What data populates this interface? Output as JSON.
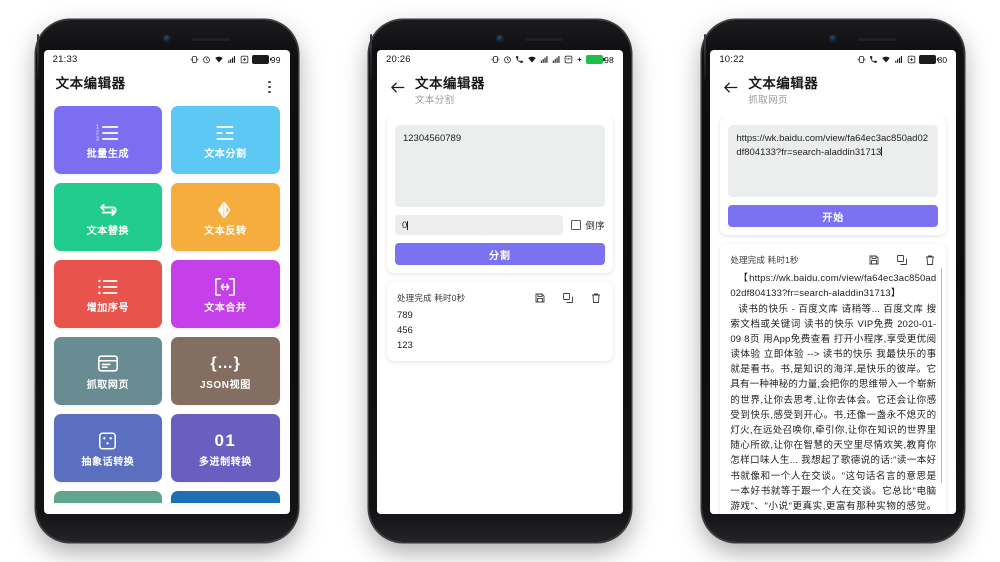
{
  "meta": {
    "app_name": "文本编辑器"
  },
  "phone1": {
    "statusbar": {
      "time": "21:33",
      "battery_level": "99",
      "battery_green": false,
      "icons": [
        "vibrate-icon",
        "alarm-icon",
        "wifi-icon",
        "signal-icon",
        "sync-icon",
        "battery-icon"
      ]
    },
    "appbar": {
      "title": "文本编辑器",
      "has_back": false,
      "overflow": "overflow-menu"
    },
    "tiles": [
      {
        "label": "批量生成",
        "color": "#7b6ef0",
        "icon": "numbered-list-icon"
      },
      {
        "label": "文本分割",
        "color": "#5ec8f5",
        "icon": "split-lines-icon"
      },
      {
        "label": "文本替换",
        "color": "#22cb8e",
        "icon": "swap-arrows-icon"
      },
      {
        "label": "文本反转",
        "color": "#f5ad3e",
        "icon": "mirror-flip-icon"
      },
      {
        "label": "增加序号",
        "color": "#e8544c",
        "icon": "bullet-list-icon"
      },
      {
        "label": "文本合并",
        "color": "#c540e8",
        "icon": "merge-icon"
      },
      {
        "label": "抓取网页",
        "color": "#688c91",
        "icon": "webpage-icon"
      },
      {
        "label": "JSON视图",
        "color": "#846e61",
        "icon": "braces-icon"
      },
      {
        "label": "抽象话转换",
        "color": "#5a6fc0",
        "icon": "dice-icon"
      },
      {
        "label": "多进制转换",
        "color": "#6a5ec0",
        "icon": "01-text-icon",
        "text_icon": "01"
      }
    ],
    "tiles_partial": [
      {
        "color": "#5fa58f"
      },
      {
        "color": "#1f6fb5"
      }
    ]
  },
  "phone2": {
    "statusbar": {
      "time": "20:26",
      "battery_level": "98",
      "battery_green": true,
      "icons": [
        "vibrate-icon",
        "alarm-icon",
        "call-icon",
        "wifi-icon",
        "signal-icon",
        "signal-icon",
        "sd-icon",
        "plus-icon",
        "battery-icon"
      ]
    },
    "appbar": {
      "title": "文本编辑器",
      "subtitle": "文本分割",
      "has_back": true
    },
    "input": {
      "value": "12304560789",
      "placeholder": ""
    },
    "separator_input": {
      "value": "0",
      "placeholder": ""
    },
    "reverse_checkbox": {
      "label": "倒序",
      "checked": false
    },
    "submit_button": {
      "label": "分割"
    },
    "result": {
      "status": "处理完成 耗时0秒",
      "actions": [
        "save-icon",
        "copy-icon",
        "delete-icon"
      ],
      "text": "789\n456\n123"
    }
  },
  "phone3": {
    "statusbar": {
      "time": "10:22",
      "battery_level": "80",
      "battery_green": false,
      "icons": [
        "vibrate-icon",
        "call-icon",
        "wifi-icon",
        "signal-icon",
        "sync-icon",
        "battery-icon"
      ]
    },
    "appbar": {
      "title": "文本编辑器",
      "subtitle": "抓取网页",
      "has_back": true
    },
    "input": {
      "value": "https://wk.baidu.com/view/fa64ec3ac850ad02df804133?fr=search-aladdin31713"
    },
    "submit_button": {
      "label": "开始"
    },
    "result": {
      "status": "处理完成 耗时1秒",
      "actions": [
        "save-icon",
        "copy-icon",
        "delete-icon"
      ],
      "url_line": "【https://wk.baidu.com/view/fa64ec3ac850ad02df804133?fr=search-aladdin31713】",
      "text": "读书的快乐 - 百度文库 请稍等... 百度文库 搜索文档或关键词 读书的快乐 VIP免费 2020-01-09 8页 用App免费查看 打开小程序,享受更优阅读体验 立即体验 --> 读书的快乐 我最快乐的事就是看书。书,是知识的海洋,是快乐的彼岸。它具有一种神秘的力量,会把你的思维带入一个崭新的世界,让你去思考,让你去体会。它还会让你感受到快乐,感受到开心。书,还像一盏永不熄灭的灯火,在远处召唤你,牵引你,让你在知识的世界里随心所欲,让你在智慧的天空里尽情欢笑,教育你怎样口味人生... 我想起了歌德说的话:\"读一本好书就像和一个人在交谈。\"这句话名言的意思是一本好书就等于跟一个人在交谈。它总比\"电脑游戏\"、\"小说\"更真实,更富有那种实物的感觉。书,是我们的朋"
    }
  }
}
